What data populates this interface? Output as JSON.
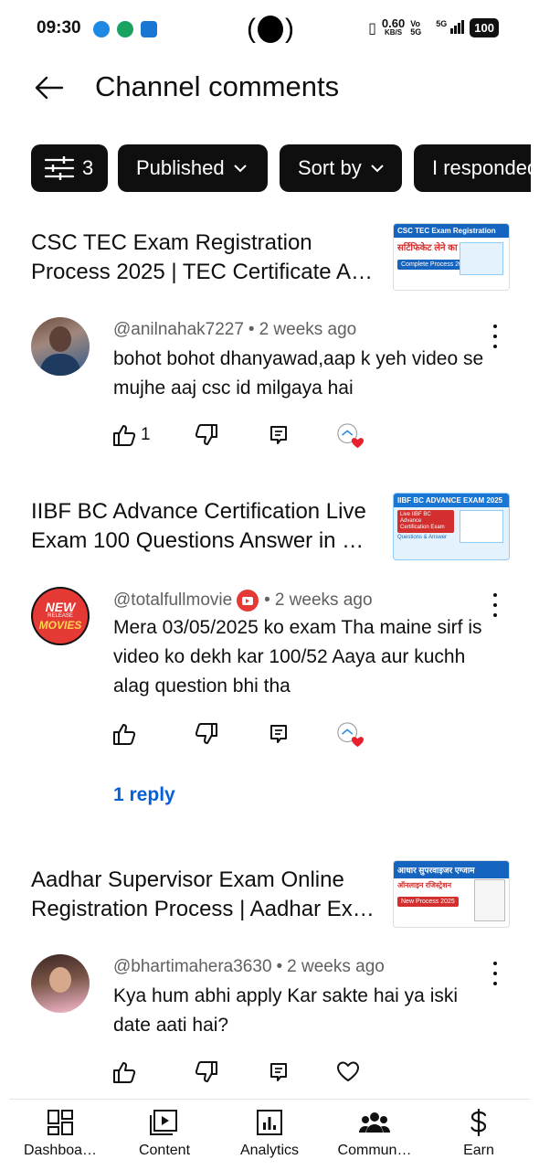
{
  "status_bar": {
    "time": "09:30",
    "net_speed": "0.60",
    "net_unit": "KB/S",
    "volte": "Vo 5G",
    "signal": "5G",
    "battery": "100"
  },
  "header": {
    "back_icon": "arrow-left-icon",
    "title": "Channel comments"
  },
  "filters": {
    "count": "3",
    "published_label": "Published",
    "sort_label": "Sort by",
    "responded_label": "I responded"
  },
  "videos": [
    {
      "title": "CSC TEC Exam Registration Process 2025 | TEC Certificate A…",
      "thumb_heading": "CSC TEC Exam Registration",
      "thumb_sub": "सर्टिफिकेट लेने का",
      "thumb_tag": "Complete Process 2025",
      "comment": {
        "handle": "@anilnahak7227",
        "time": "2 weeks ago",
        "text": "bohot bohot dhanyawad,aap k yeh video se mujhe aaj csc id milgaya hai",
        "likes": "1"
      }
    },
    {
      "title": "IIBF BC Advance Certification Live Exam 100 Questions Answer in …",
      "thumb_heading": "IIBF BC ADVANCE EXAM 2025",
      "thumb_sub": "Live IIBF BC Advance Certification Exam",
      "thumb_tag": "Questions & Answer",
      "comment": {
        "handle": "@totalfullmovie",
        "time": "2 weeks ago",
        "text": "Mera 03/05/2025 ko exam Tha maine sirf is video ko dekh kar 100/52 Aaya aur kuchh alag question bhi tha",
        "likes": "",
        "avatar_text_1": "NEW",
        "avatar_text_2": "RELEASE",
        "avatar_text_3": "MOVIES"
      },
      "reply_label": "1 reply"
    },
    {
      "title": "Aadhar Supervisor Exam Online Registration Process | Aadhar Ex…",
      "thumb_heading": "आधार सुपरवाइजर एग्जाम",
      "thumb_sub": "ऑनलाइन रजिस्ट्रेशन",
      "thumb_tag": "New Process 2025",
      "comment": {
        "handle": "@bhartimahera3630",
        "time": "2 weeks ago",
        "text": "Kya hum abhi apply  Kar sakte hai ya iski date aati hai?",
        "likes": ""
      }
    }
  ],
  "bottom_nav": [
    {
      "label": "Dashboa…",
      "icon": "dashboard-icon"
    },
    {
      "label": "Content",
      "icon": "content-icon"
    },
    {
      "label": "Analytics",
      "icon": "analytics-icon"
    },
    {
      "label": "Commun…",
      "icon": "community-icon"
    },
    {
      "label": "Earn",
      "icon": "dollar-icon"
    }
  ],
  "colors": {
    "chip_bg": "#0f0f0f",
    "link_blue": "#065fd4",
    "heart_red": "#e8202b",
    "meta_gray": "#606060"
  }
}
